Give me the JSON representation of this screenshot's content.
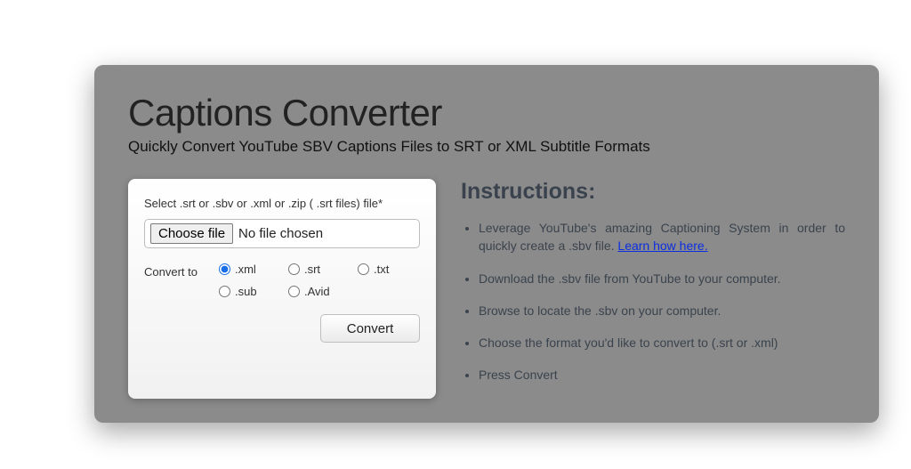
{
  "header": {
    "title": "Captions Converter",
    "subtitle": "Quickly Convert YouTube SBV Captions Files to SRT or XML Subtitle Formats"
  },
  "form": {
    "file_label": "Select .srt or .sbv or .xml or .zip ( .srt files) file*",
    "choose_button": "Choose file",
    "file_status": "No file chosen",
    "convert_to_label": "Convert to",
    "options": {
      "xml": ".xml",
      "srt": ".srt",
      "txt": ".txt",
      "sub": ".sub",
      "avid": ".Avid"
    },
    "convert_button": "Convert"
  },
  "instructions": {
    "heading": "Instructions:",
    "items": {
      "0_pre": "Leverage YouTube's amazing Captioning System in order to quickly create a .sbv file. ",
      "0_link": "Learn how here.",
      "1": "Download the .sbv file from YouTube to your computer.",
      "2": "Browse to locate the .sbv on your computer.",
      "3": "Choose the format you'd like to convert to (.srt or .xml)",
      "4": "Press Convert"
    }
  }
}
